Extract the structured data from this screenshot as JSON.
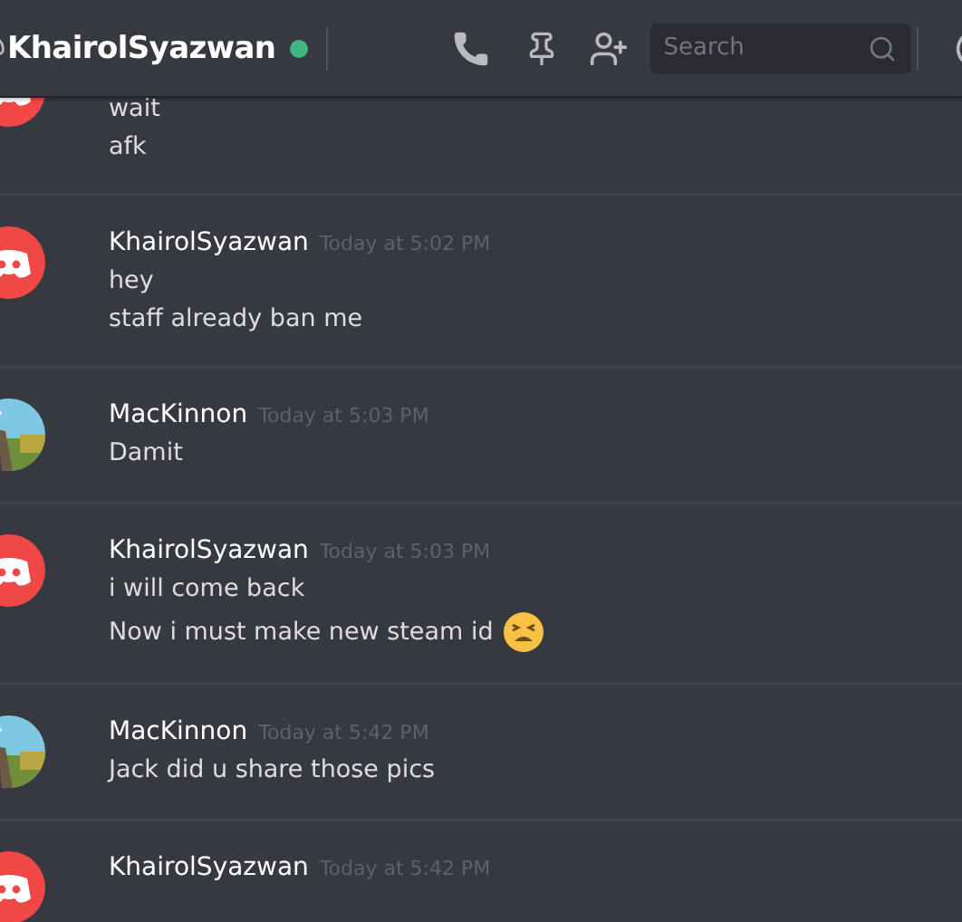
{
  "header": {
    "channel_name": "KhairolSyazwan",
    "online": true,
    "search": {
      "placeholder": "Search"
    }
  },
  "messages": [
    {
      "kind": "default",
      "lines": [
        "wait",
        "afk"
      ]
    },
    {
      "kind": "default",
      "author": "KhairolSyazwan",
      "time": "Today at 5:02 PM",
      "lines": [
        "hey",
        "staff already ban me"
      ]
    },
    {
      "author": "MacKinnon",
      "time": "Today at 5:03 PM",
      "lines": [
        "Damit"
      ]
    },
    {
      "kind": "default",
      "author": "KhairolSyazwan",
      "time": "Today at 5:03 PM",
      "lines": [
        "i will come back",
        "Now i must make new steam id"
      ],
      "emoji_after_last": true
    },
    {
      "author": "MacKinnon",
      "time": "Today at 5:42 PM",
      "lines": [
        "Jack did u share those pics"
      ]
    },
    {
      "kind": "default",
      "author": "KhairolSyazwan",
      "time": "Today at 5:42 PM"
    }
  ]
}
